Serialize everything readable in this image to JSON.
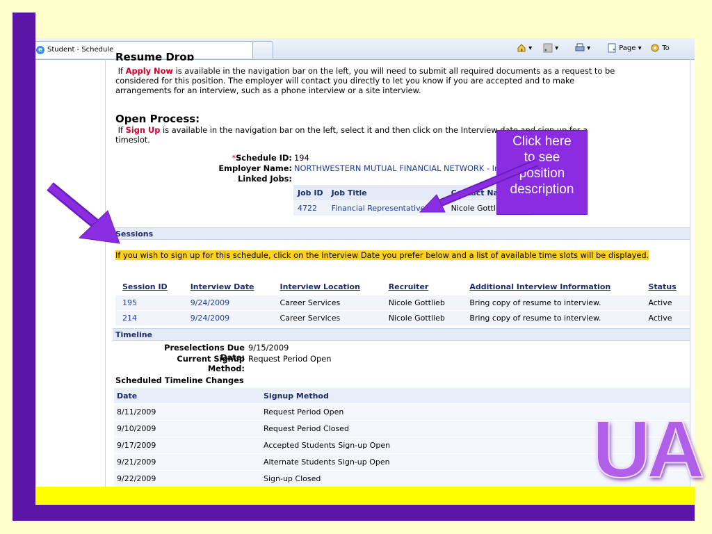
{
  "browser": {
    "tab_title": "Student - Schedule",
    "toolbar": {
      "home": "",
      "feeds": "",
      "print": "",
      "page_label": "Page ▾",
      "tools_label": "To"
    }
  },
  "resume_drop": {
    "heading_partial": "Resume Drop",
    "line_prefix": "If",
    "keyword": "Apply Now",
    "line1_rest": "is available in the navigation bar on the left, you will need to submit all required documents as a request to be",
    "line2": "considered for this position.  The employer will contact you directly to let you know if you are accepted and to make",
    "line3": "arrangements for an interview, such as a phone interview or a site interview."
  },
  "open_process": {
    "heading": "Open Process:",
    "line_prefix": "If",
    "keyword": "Sign Up",
    "line1_rest": "is available in the navigation bar on the left, select it and then click on the Interview date and sign up for a",
    "line2": "timeslot."
  },
  "schedule": {
    "required_mark": "*",
    "id_label": "Schedule ID:",
    "id_value": "194",
    "employer_label": "Employer Name:",
    "employer_value": "NORTHWESTERN MUTUAL FINANCIAL NETWORK - Indian",
    "linked_jobs_label": "Linked Jobs:",
    "jobs_headers": [
      "Job ID",
      "Job Title",
      "Contact Name"
    ],
    "jobs_rows": [
      [
        "4722",
        "Financial Representative",
        "Nicole Gottlieb"
      ]
    ]
  },
  "callout": {
    "line1": "Click here",
    "line2": "to see",
    "line3": "position",
    "line4": "description"
  },
  "sessions": {
    "header": "Sessions",
    "notice": "If you wish to sign up for this schedule, click on the Interview Date you prefer below and a list of available time slots will be displayed.",
    "columns": [
      "Session ID",
      "Interview Date",
      "Interview Location",
      "Recruiter",
      "Additional Interview Information",
      "Status"
    ],
    "rows": [
      [
        "195",
        "9/24/2009",
        "Career Services",
        "Nicole Gottlieb",
        "Bring copy of resume to interview.",
        "Active"
      ],
      [
        "214",
        "9/24/2009",
        "Career Services",
        "Nicole Gottlieb",
        "Bring copy of resume to interview.",
        "Active"
      ]
    ]
  },
  "timeline": {
    "header": "Timeline",
    "preselections_label": "Preselections Due Date:",
    "preselections_value": "9/15/2009",
    "signup_method_label": "Current Signup Method:",
    "signup_method_value": "Request Period Open",
    "changes_title": "Scheduled Timeline Changes",
    "columns": [
      "Date",
      "Signup Method"
    ],
    "rows": [
      [
        "8/11/2009",
        "Request Period Open"
      ],
      [
        "9/10/2009",
        "Request Period Closed"
      ],
      [
        "9/17/2009",
        "Accepted Students Sign-up Open"
      ],
      [
        "9/21/2009",
        "Alternate Students Sign-up Open"
      ],
      [
        "9/22/2009",
        "Sign-up Closed"
      ]
    ]
  },
  "logo": {
    "text": "UA"
  },
  "colors": {
    "slide_bg": "#ffffcc",
    "purple": "#5b16a8",
    "callout": "#8a2ce0",
    "highlight": "#ffd21e",
    "link": "#1d3c9e"
  }
}
